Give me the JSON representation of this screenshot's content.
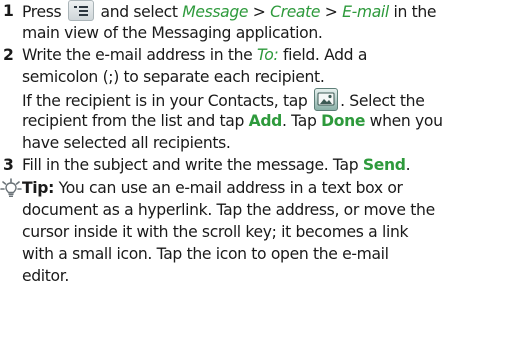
{
  "steps": [
    {
      "number": "1",
      "line1_pre": "Press ",
      "line1_mid": " and select ",
      "crumb_message": "Message",
      "crumb_sep1": " > ",
      "crumb_create": "Create",
      "crumb_sep2": " > ",
      "crumb_email": "E-mail",
      "line1_post": " in the",
      "line2": "main view of the Messaging application."
    },
    {
      "number": "2",
      "line1_pre": "Write the e-mail address in the ",
      "to_field": "To:",
      "line1_post": " field. Add a",
      "line2": "semicolon (;) to separate each recipient.",
      "line3_pre": "If the recipient is in your Contacts, tap ",
      "line3_post": ". Select the",
      "line4_pre": "recipient from the list and tap ",
      "add_label": "Add",
      "line4_mid": ". Tap ",
      "done_label": "Done",
      "line4_post": " when you",
      "line5": "have selected all recipients."
    },
    {
      "number": "3",
      "line1_pre": "Fill in the subject and write the message. Tap ",
      "send_label": "Send",
      "line1_post": "."
    }
  ],
  "tip": {
    "label": "Tip:",
    "line1": " You can use an e-mail address in a text box or",
    "line2": "document as a hyperlink. Tap the address, or move the",
    "line3": "cursor inside it with the scroll key; it becomes a link",
    "line4": "with a small icon. Tap the icon to open the e-mail",
    "line5": "editor."
  },
  "icons": {
    "menu": "menu-list-icon",
    "contacts": "contacts-icon",
    "tip": "lightbulb-tip-icon"
  },
  "colors": {
    "accent_green": "#2e9a3c",
    "text": "#1a1a1a"
  }
}
